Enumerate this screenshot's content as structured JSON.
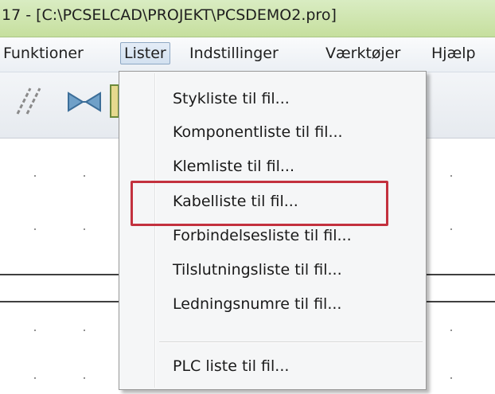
{
  "window": {
    "title": "17 - [C:\\PCSELCAD\\PROJEKT\\PCSDEMO2.pro]"
  },
  "menubar": {
    "items": [
      {
        "label": "Funktioner"
      },
      {
        "label": "Lister"
      },
      {
        "label": "Indstillinger"
      },
      {
        "label": "Værktøjer"
      },
      {
        "label": "Hjælp"
      }
    ]
  },
  "toolbar": {
    "icons": [
      "wire-tool-icon",
      "connector-tool-icon",
      "symbol-tool-icon"
    ]
  },
  "dropdown": {
    "items": [
      {
        "label": "Stykliste til fil..."
      },
      {
        "label": "Komponentliste til fil..."
      },
      {
        "label": "Klemliste til fil..."
      },
      {
        "label": "Kabelliste til fil..."
      },
      {
        "label": "Forbindelsesliste til fil..."
      },
      {
        "label": "Tilslutningsliste til fil..."
      },
      {
        "label": "Ledningsnumre til fil..."
      },
      {
        "label": "PLC liste til fil..."
      }
    ],
    "highlighted": "Kabelliste til fil...",
    "highlight_color": "#c3313e"
  }
}
